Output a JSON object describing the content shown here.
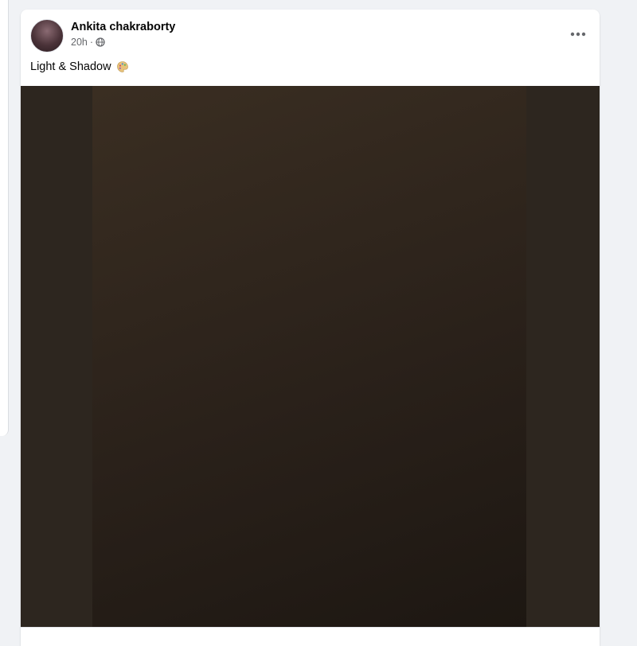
{
  "post": {
    "author": "Ankita chakraborty",
    "time": "20h",
    "separator": "·",
    "audience_icon": "globe-icon",
    "more_icon": "more-horizontal-icon",
    "caption": "Light & Shadow",
    "caption_emoji": "palette-icon"
  },
  "colors": {
    "page_background": "#f0f2f5",
    "card": "#ffffff",
    "author_text": "#050505",
    "meta_text": "#65676b",
    "photo_frame": "#2d261f"
  }
}
